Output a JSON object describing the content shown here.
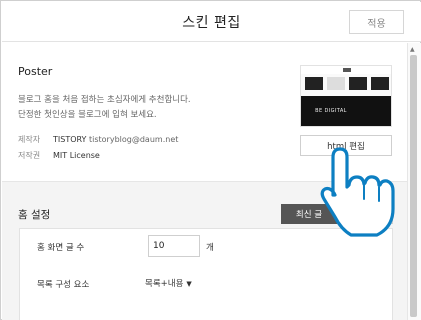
{
  "header": {
    "title": "스킨 편집",
    "apply_label": "적용"
  },
  "skin": {
    "name": "Poster",
    "description_line1": "블로그 홈을 처음 접하는 초심자에게 추천합니다.",
    "description_line2": "단정한 첫인상을 블로그에 입혀 보세요.",
    "author_label": "제작자",
    "author_name": "TISTORY",
    "author_email": "tistoryblog@daum.net",
    "license_label": "저작권",
    "license_value": "MIT License",
    "preview_text": "BE DIGITAL",
    "html_edit_label": "html 편집"
  },
  "home_settings": {
    "title": "홈 설정",
    "latest_label": "최신 글",
    "count_label": "홈 화면 글 수",
    "count_value": "10",
    "count_unit": "개",
    "list_label": "목록 구성 요소",
    "list_value": "목록+내용",
    "caret": "▼"
  },
  "scroll": {
    "up_arrow": "▲"
  },
  "icons": {
    "cursor": "hand-pointer-icon"
  },
  "colors": {
    "latest_bg": "#555555",
    "section_bg": "#f4f4f4",
    "cursor_outline": "#0d7fc2"
  }
}
